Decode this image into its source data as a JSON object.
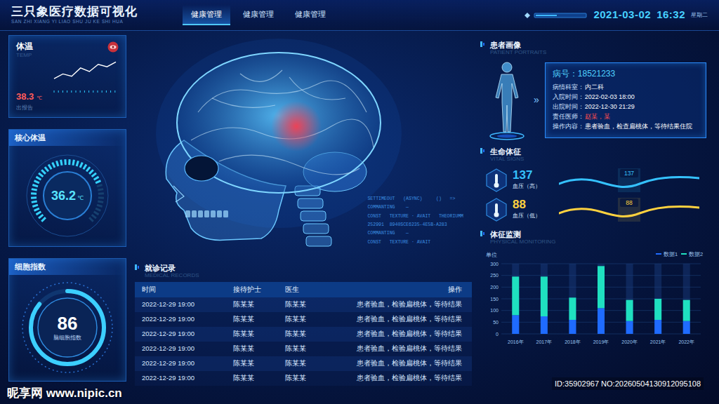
{
  "header": {
    "title": "三只象医疗数据可视化",
    "subtitle": "SAN ZHI XIANG YI LIAO SHU JU KE SHI HUA",
    "date": "2021-03-02",
    "time": "16:32",
    "weekday": "星期二"
  },
  "tabs": [
    {
      "label": "健康管理",
      "selected": true
    },
    {
      "label": "健康管理",
      "selected": false
    },
    {
      "label": "健康管理",
      "selected": false
    }
  ],
  "temperature": {
    "title": "体温",
    "subtitle": "TEMP",
    "value": "38.3",
    "unit": "℃",
    "note": "出报告",
    "series": [
      36.9,
      37.3,
      37.1,
      37.8,
      37.5,
      38.1,
      37.9,
      38.3
    ]
  },
  "core_temp": {
    "title": "核心体温",
    "value": "36.2",
    "unit": "℃",
    "level": 0.75
  },
  "cell_index": {
    "title": "细胞指数",
    "value": "86",
    "label": "脑细胞指数",
    "level": 0.86
  },
  "code_lines": [
    "SETTIMEOUT   (ASYNC)     ()   =>",
    "COMMANTING    —",
    "CONST   TEXTURE · AVAIT   THEORIUMM",
    "252991  8940SCE6235-4E5B-A283",
    "COMMANTING    —",
    "CONST   TEXTURE · AVAIT"
  ],
  "records": {
    "title": "就诊记录",
    "subtitle": "MEDICAL RECORDS",
    "columns": [
      "时间",
      "接待护士",
      "医生",
      "操作"
    ],
    "rows": [
      [
        "2022-12-29  19:00",
        "陈某某",
        "陈某某",
        "患者验血，检验扁桃体，等待结果"
      ],
      [
        "2022-12-29  19:00",
        "陈某某",
        "陈某某",
        "患者验血，检验扁桃体，等待结果"
      ],
      [
        "2022-12-29  19:00",
        "陈某某",
        "陈某某",
        "患者验血，检验扁桃体，等待结果"
      ],
      [
        "2022-12-29  19:00",
        "陈某某",
        "陈某某",
        "患者验血，检验扁桃体，等待结果"
      ],
      [
        "2022-12-29  19:00",
        "陈某某",
        "陈某某",
        "患者验血，检验扁桃体，等待结果"
      ],
      [
        "2022-12-29  19:00",
        "陈某某",
        "陈某某",
        "患者验血，检验扁桃体，等待结果"
      ]
    ]
  },
  "patient": {
    "title": "患者画像",
    "subtitle": "PATIENT PORTRAITS",
    "arrow": "»",
    "id_label": "病号：",
    "id": "18521233",
    "fields": [
      {
        "label": "病情科室：",
        "value": "内二科",
        "color": "#ffffff"
      },
      {
        "label": "入院时间：",
        "value": "2022-02-03  18:00",
        "color": "#ffffff"
      },
      {
        "label": "出院时间：",
        "value": "2022-12-30  21:29",
        "color": "#ffffff"
      },
      {
        "label": "责任医师：",
        "value": "赵某，某",
        "color": "#ff4d4d"
      },
      {
        "label": "操作内容：",
        "value": "患者验血，检查扁桃体，等待结果住院",
        "color": "#ffffff"
      }
    ]
  },
  "vitals": {
    "title": "生命体征",
    "subtitle": "VITAL SIGNS",
    "items": [
      {
        "value": "137",
        "label": "血压（高）",
        "wave_label": "137",
        "color": "#35c2ff"
      },
      {
        "value": "88",
        "label": "血压（低）",
        "wave_label": "88",
        "color": "#ffd23f"
      }
    ]
  },
  "monitoring": {
    "title": "体征监测",
    "subtitle": "PHYSICAL MONITORING",
    "unit": "单位",
    "y_ticks": [
      "300",
      "250",
      "200",
      "150",
      "100",
      "50",
      "0"
    ],
    "x_labels": [
      "2016年",
      "2017年",
      "2018年",
      "2019年",
      "2020年",
      "2021年",
      "2022年"
    ],
    "series": [
      {
        "name": "数据1",
        "color": "#1f6bff",
        "values": [
          80,
          75,
          60,
          110,
          55,
          60,
          55
        ]
      },
      {
        "name": "数据2",
        "color": "#1fe0c0",
        "values": [
          165,
          170,
          95,
          180,
          90,
          90,
          90
        ]
      }
    ]
  },
  "watermark": {
    "site": "昵享网 www.nipic.cn",
    "id": "ID:35902967 NO:20260504130912095108"
  }
}
